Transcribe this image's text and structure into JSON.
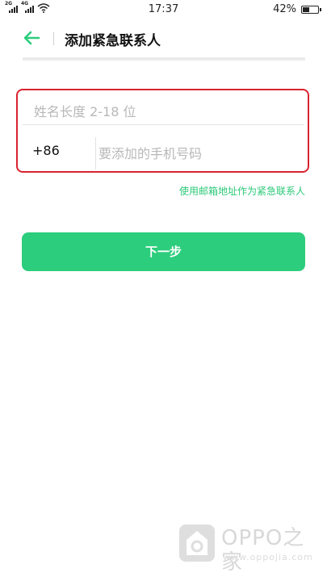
{
  "status_bar": {
    "signal_1_label": "2G",
    "signal_2_label": "4G",
    "time": "17:37",
    "battery_percent": "42%",
    "battery_level": 0.42
  },
  "header": {
    "back_icon": "arrow-left-icon",
    "title": "添加紧急联系人"
  },
  "form": {
    "name_placeholder": "姓名长度 2-18 位",
    "name_value": "",
    "country_code": "+86",
    "phone_placeholder": "要添加的手机号码",
    "phone_value": ""
  },
  "email_link": "使用邮箱地址作为紧急联系人",
  "next_button": "下一步",
  "watermark": {
    "brand": "OPPO之家",
    "url": "www.oppojia.com"
  },
  "colors": {
    "accent": "#2ccd7c",
    "highlight_border": "#d9232f"
  }
}
